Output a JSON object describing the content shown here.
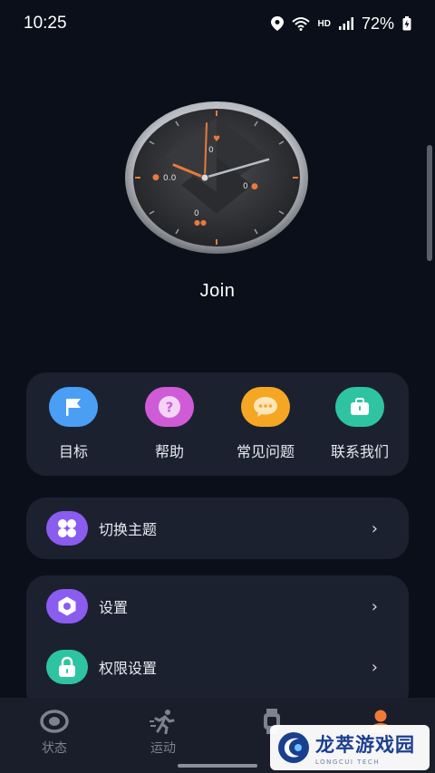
{
  "status_bar": {
    "time": "10:25",
    "network": "HD",
    "battery": "72%",
    "icons": [
      "location-icon",
      "wifi-icon",
      "signal-icon",
      "battery-charging-icon"
    ]
  },
  "device": {
    "name": "Join"
  },
  "quick_actions": [
    {
      "label": "目标",
      "icon": "flag-icon",
      "color": "#4a9ff5"
    },
    {
      "label": "帮助",
      "icon": "question-icon",
      "color": "#cf5cd6"
    },
    {
      "label": "常见问题",
      "icon": "chat-bubble-icon",
      "color": "#f5a623"
    },
    {
      "label": "联系我们",
      "icon": "briefcase-icon",
      "color": "#2ec4a1"
    }
  ],
  "theme_row": {
    "label": "切换主题",
    "icon": "grid-petals-icon",
    "color": "#8a5cf0",
    "chevron": "›"
  },
  "settings_rows": [
    {
      "label": "设置",
      "icon": "hexagon-settings-icon",
      "color": "#8a5cf0",
      "chevron": "›"
    },
    {
      "label": "权限设置",
      "icon": "lock-icon",
      "color": "#2ec4a1",
      "chevron": "›"
    }
  ],
  "bottom_nav": [
    {
      "label": "状态",
      "icon": "eye-icon",
      "active": false
    },
    {
      "label": "运动",
      "icon": "running-icon",
      "active": false
    },
    {
      "label": "",
      "icon": "watch-icon",
      "active": false
    },
    {
      "label": "",
      "icon": "person-icon",
      "active": true
    }
  ],
  "watermark": {
    "main": "龙萃游戏园",
    "sub": "LONGCUI TECH"
  }
}
